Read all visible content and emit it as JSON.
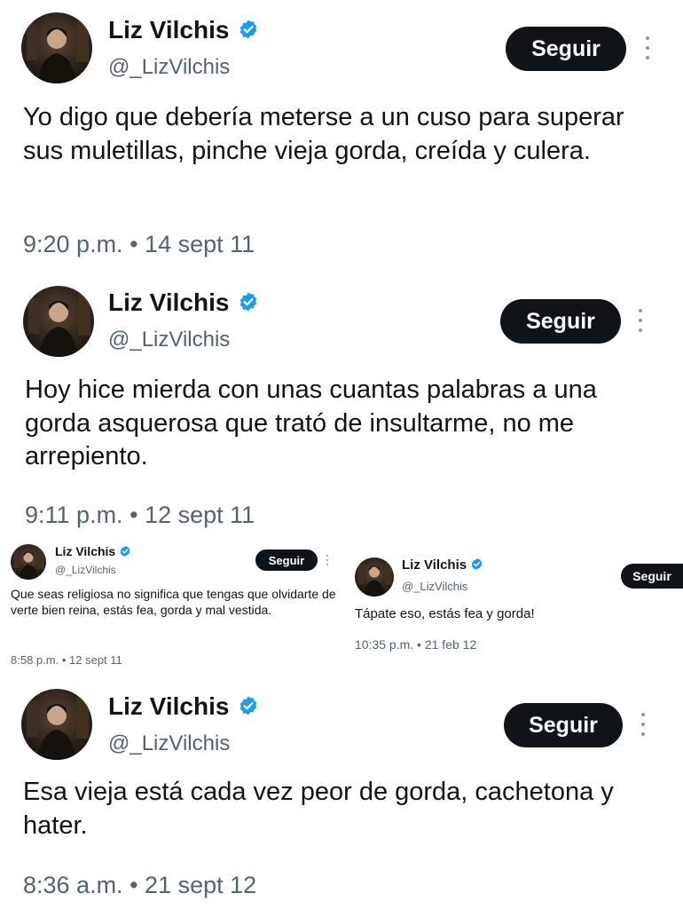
{
  "tweets": [
    {
      "display_name": "Liz Vilchis",
      "handle": "@_LizVilchis",
      "follow_label": "Seguir",
      "text": "Yo digo que debería meterse a un cuso para superar sus muletillas, pinche vieja gorda, creída y culera.",
      "time": "9:20 p.m.",
      "separator": "•",
      "date": "14 sept 11"
    },
    {
      "display_name": "Liz Vilchis",
      "handle": "@_LizVilchis",
      "follow_label": "Seguir",
      "text": "Hoy hice mierda con unas cuantas palabras a una gorda asquerosa que trató de insultarme, no me arrepiento.",
      "time": "9:11 p.m.",
      "separator": "•",
      "date": "12 sept 11"
    },
    {
      "display_name": "Liz Vilchis",
      "handle": "@_LizVilchis",
      "follow_label": "Seguir",
      "text": "Que seas religiosa no significa que tengas que olvidarte de verte bien reina, estás fea, gorda y mal vestida.",
      "time": "8:58 p.m.",
      "separator": "•",
      "date": "12 sept 11"
    },
    {
      "display_name": "Liz Vilchis",
      "handle": "@_LizVilchis",
      "follow_label": "Seguir",
      "text": "Tápate eso, estás fea y gorda!",
      "time": "10:35 p.m.",
      "separator": "•",
      "date": "21 feb 12"
    },
    {
      "display_name": "Liz Vilchis",
      "handle": "@_LizVilchis",
      "follow_label": "Seguir",
      "text": "Esa vieja está cada vez peor de gorda, cachetona y hater.",
      "time": "8:36 a.m.",
      "separator": "•",
      "date": "21 sept 12"
    }
  ],
  "colors": {
    "text": "#0f1419",
    "secondary": "#536471",
    "verified": "#1d9bf0",
    "button_bg": "#0f1419",
    "button_text": "#ffffff"
  },
  "icons": {
    "verified": "verified-badge-icon",
    "more": "more-options-icon"
  }
}
